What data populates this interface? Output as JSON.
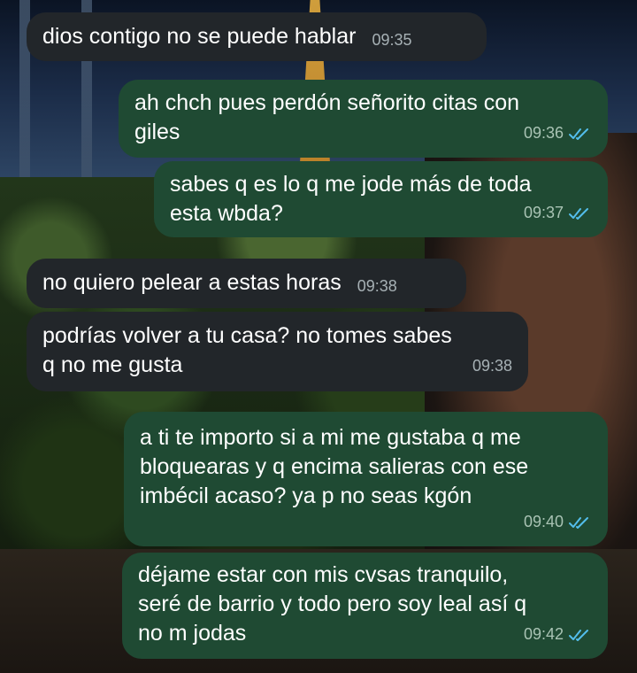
{
  "theme": {
    "incoming_bubble": "#22262a",
    "outgoing_bubble": "#1f4a33",
    "read_ticks": "#53bdeb"
  },
  "messages": [
    {
      "direction": "incoming",
      "text": "dios contigo no se puede hablar",
      "time": "09:35"
    },
    {
      "direction": "outgoing",
      "text": "ah chch pues perdón señorito citas con\ngiles",
      "time": "09:36",
      "status": "read"
    },
    {
      "direction": "outgoing",
      "text": "sabes q es lo q me jode más de toda\nesta wbda?",
      "time": "09:37",
      "status": "read"
    },
    {
      "direction": "incoming",
      "text": "no quiero pelear a estas horas",
      "time": "09:38"
    },
    {
      "direction": "incoming",
      "text": "podrías volver a tu casa? no tomes sabes\nq no me gusta",
      "time": "09:38"
    },
    {
      "direction": "outgoing",
      "text": "a ti te importo si a mi me gustaba q me\nbloquearas y q encima salieras con ese\nimbécil acaso? ya p no seas kgón",
      "time": "09:40",
      "status": "read"
    },
    {
      "direction": "outgoing",
      "text": "déjame estar con mis cvsas tranquilo,\nseré de barrio y todo pero soy leal así q\nno m jodas",
      "time": "09:42",
      "status": "read"
    }
  ]
}
